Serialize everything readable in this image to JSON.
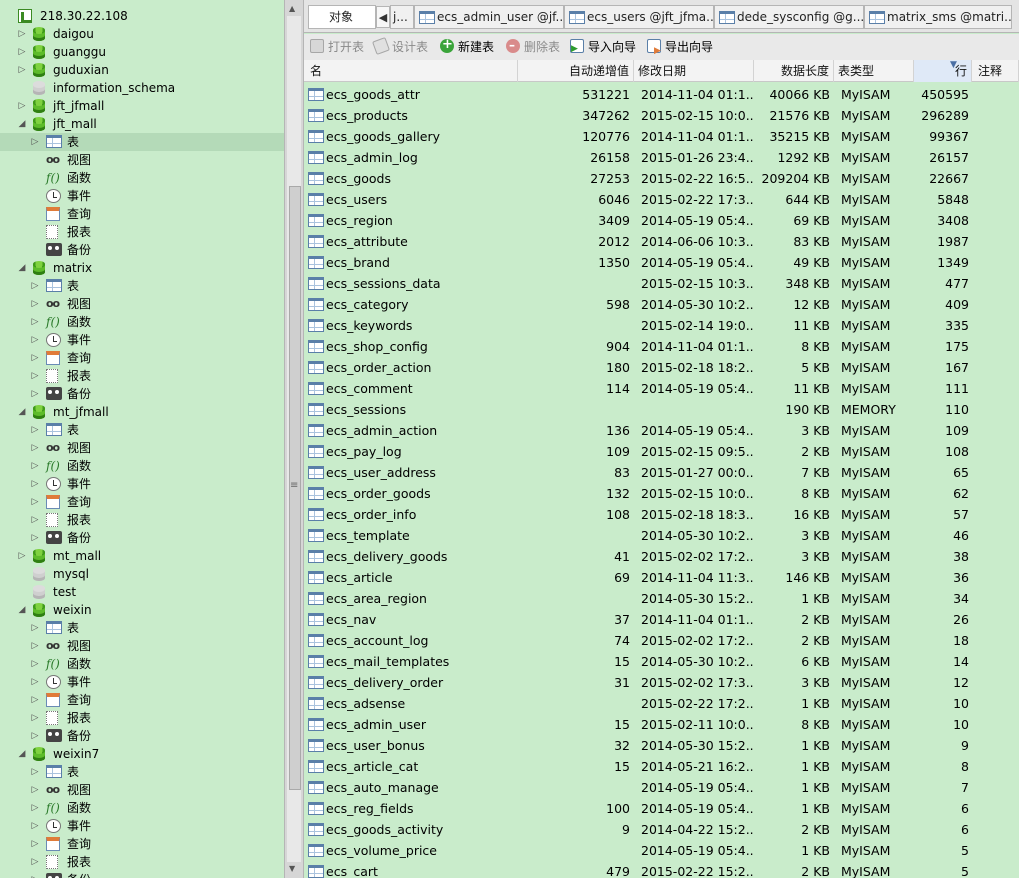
{
  "tree": {
    "server": "218.30.22.108",
    "items": [
      {
        "label": "daigou",
        "type": "db",
        "depth": 1,
        "twisty": "▷"
      },
      {
        "label": "guanggu",
        "type": "db",
        "depth": 1,
        "twisty": "▷"
      },
      {
        "label": "guduxian",
        "type": "db",
        "depth": 1,
        "twisty": "▷"
      },
      {
        "label": "information_schema",
        "type": "db-gray",
        "depth": 1,
        "twisty": ""
      },
      {
        "label": "jft_jfmall",
        "type": "db",
        "depth": 1,
        "twisty": "▷"
      },
      {
        "label": "jft_mall",
        "type": "db",
        "depth": 1,
        "twisty": "◢"
      },
      {
        "label": "表",
        "type": "table",
        "depth": 2,
        "twisty": "▷",
        "selected": true
      },
      {
        "label": "视图",
        "type": "view",
        "depth": 2,
        "twisty": ""
      },
      {
        "label": "函数",
        "type": "func",
        "depth": 2,
        "twisty": ""
      },
      {
        "label": "事件",
        "type": "event",
        "depth": 2,
        "twisty": ""
      },
      {
        "label": "查询",
        "type": "query",
        "depth": 2,
        "twisty": ""
      },
      {
        "label": "报表",
        "type": "report",
        "depth": 2,
        "twisty": ""
      },
      {
        "label": "备份",
        "type": "backup",
        "depth": 2,
        "twisty": ""
      },
      {
        "label": "matrix",
        "type": "db",
        "depth": 1,
        "twisty": "◢"
      },
      {
        "label": "表",
        "type": "table",
        "depth": 2,
        "twisty": "▷"
      },
      {
        "label": "视图",
        "type": "view",
        "depth": 2,
        "twisty": "▷"
      },
      {
        "label": "函数",
        "type": "func",
        "depth": 2,
        "twisty": "▷"
      },
      {
        "label": "事件",
        "type": "event",
        "depth": 2,
        "twisty": "▷"
      },
      {
        "label": "查询",
        "type": "query",
        "depth": 2,
        "twisty": "▷"
      },
      {
        "label": "报表",
        "type": "report",
        "depth": 2,
        "twisty": "▷"
      },
      {
        "label": "备份",
        "type": "backup",
        "depth": 2,
        "twisty": "▷"
      },
      {
        "label": "mt_jfmall",
        "type": "db",
        "depth": 1,
        "twisty": "◢"
      },
      {
        "label": "表",
        "type": "table",
        "depth": 2,
        "twisty": "▷"
      },
      {
        "label": "视图",
        "type": "view",
        "depth": 2,
        "twisty": "▷"
      },
      {
        "label": "函数",
        "type": "func",
        "depth": 2,
        "twisty": "▷"
      },
      {
        "label": "事件",
        "type": "event",
        "depth": 2,
        "twisty": "▷"
      },
      {
        "label": "查询",
        "type": "query",
        "depth": 2,
        "twisty": "▷"
      },
      {
        "label": "报表",
        "type": "report",
        "depth": 2,
        "twisty": "▷"
      },
      {
        "label": "备份",
        "type": "backup",
        "depth": 2,
        "twisty": "▷"
      },
      {
        "label": "mt_mall",
        "type": "db",
        "depth": 1,
        "twisty": "▷"
      },
      {
        "label": "mysql",
        "type": "db-gray",
        "depth": 1,
        "twisty": ""
      },
      {
        "label": "test",
        "type": "db-gray",
        "depth": 1,
        "twisty": ""
      },
      {
        "label": "weixin",
        "type": "db",
        "depth": 1,
        "twisty": "◢"
      },
      {
        "label": "表",
        "type": "table",
        "depth": 2,
        "twisty": "▷"
      },
      {
        "label": "视图",
        "type": "view",
        "depth": 2,
        "twisty": "▷"
      },
      {
        "label": "函数",
        "type": "func",
        "depth": 2,
        "twisty": "▷"
      },
      {
        "label": "事件",
        "type": "event",
        "depth": 2,
        "twisty": "▷"
      },
      {
        "label": "查询",
        "type": "query",
        "depth": 2,
        "twisty": "▷"
      },
      {
        "label": "报表",
        "type": "report",
        "depth": 2,
        "twisty": "▷"
      },
      {
        "label": "备份",
        "type": "backup",
        "depth": 2,
        "twisty": "▷"
      },
      {
        "label": "weixin7",
        "type": "db",
        "depth": 1,
        "twisty": "◢"
      },
      {
        "label": "表",
        "type": "table",
        "depth": 2,
        "twisty": "▷"
      },
      {
        "label": "视图",
        "type": "view",
        "depth": 2,
        "twisty": "▷"
      },
      {
        "label": "函数",
        "type": "func",
        "depth": 2,
        "twisty": "▷"
      },
      {
        "label": "事件",
        "type": "event",
        "depth": 2,
        "twisty": "▷"
      },
      {
        "label": "查询",
        "type": "query",
        "depth": 2,
        "twisty": "▷"
      },
      {
        "label": "报表",
        "type": "report",
        "depth": 2,
        "twisty": "▷"
      },
      {
        "label": "备份",
        "type": "backup",
        "depth": 2,
        "twisty": "▷"
      }
    ]
  },
  "tabs": {
    "active": "对象",
    "items": [
      "j...",
      "ecs_admin_user @jf...",
      "ecs_users @jft_jfma...",
      "dede_sysconfig @g...",
      "matrix_sms @matri..."
    ]
  },
  "toolbar": {
    "open": "打开表",
    "design": "设计表",
    "new": "新建表",
    "delete": "删除表",
    "import": "导入向导",
    "export": "导出向导"
  },
  "columns": {
    "name": "名",
    "auto_increment": "自动递增值",
    "modified": "修改日期",
    "data_length": "数据长度",
    "engine": "表类型",
    "rows": "行",
    "comment": "注释"
  },
  "rows": [
    {
      "name": "ecs_goods_attr",
      "auto": "531221",
      "date": "2014-11-04 01:1...",
      "size": "40066 KB",
      "engine": "MyISAM",
      "rows": "450595"
    },
    {
      "name": "ecs_products",
      "auto": "347262",
      "date": "2015-02-15 10:0...",
      "size": "21576 KB",
      "engine": "MyISAM",
      "rows": "296289"
    },
    {
      "name": "ecs_goods_gallery",
      "auto": "120776",
      "date": "2014-11-04 01:1...",
      "size": "35215 KB",
      "engine": "MyISAM",
      "rows": "99367"
    },
    {
      "name": "ecs_admin_log",
      "auto": "26158",
      "date": "2015-01-26 23:4...",
      "size": "1292 KB",
      "engine": "MyISAM",
      "rows": "26157"
    },
    {
      "name": "ecs_goods",
      "auto": "27253",
      "date": "2015-02-22 16:5...",
      "size": "209204 KB",
      "engine": "MyISAM",
      "rows": "22667"
    },
    {
      "name": "ecs_users",
      "auto": "6046",
      "date": "2015-02-22 17:3...",
      "size": "644 KB",
      "engine": "MyISAM",
      "rows": "5848"
    },
    {
      "name": "ecs_region",
      "auto": "3409",
      "date": "2014-05-19 05:4...",
      "size": "69 KB",
      "engine": "MyISAM",
      "rows": "3408"
    },
    {
      "name": "ecs_attribute",
      "auto": "2012",
      "date": "2014-06-06 10:3...",
      "size": "83 KB",
      "engine": "MyISAM",
      "rows": "1987"
    },
    {
      "name": "ecs_brand",
      "auto": "1350",
      "date": "2014-05-19 05:4...",
      "size": "49 KB",
      "engine": "MyISAM",
      "rows": "1349"
    },
    {
      "name": "ecs_sessions_data",
      "auto": "",
      "date": "2015-02-15 10:3...",
      "size": "348 KB",
      "engine": "MyISAM",
      "rows": "477"
    },
    {
      "name": "ecs_category",
      "auto": "598",
      "date": "2014-05-30 10:2...",
      "size": "12 KB",
      "engine": "MyISAM",
      "rows": "409"
    },
    {
      "name": "ecs_keywords",
      "auto": "",
      "date": "2015-02-14 19:0...",
      "size": "11 KB",
      "engine": "MyISAM",
      "rows": "335"
    },
    {
      "name": "ecs_shop_config",
      "auto": "904",
      "date": "2014-11-04 01:1...",
      "size": "8 KB",
      "engine": "MyISAM",
      "rows": "175"
    },
    {
      "name": "ecs_order_action",
      "auto": "180",
      "date": "2015-02-18 18:2...",
      "size": "5 KB",
      "engine": "MyISAM",
      "rows": "167"
    },
    {
      "name": "ecs_comment",
      "auto": "114",
      "date": "2014-05-19 05:4...",
      "size": "11 KB",
      "engine": "MyISAM",
      "rows": "111"
    },
    {
      "name": "ecs_sessions",
      "auto": "",
      "date": "",
      "size": "190 KB",
      "engine": "MEMORY",
      "rows": "110"
    },
    {
      "name": "ecs_admin_action",
      "auto": "136",
      "date": "2014-05-19 05:4...",
      "size": "3 KB",
      "engine": "MyISAM",
      "rows": "109"
    },
    {
      "name": "ecs_pay_log",
      "auto": "109",
      "date": "2015-02-15 09:5...",
      "size": "2 KB",
      "engine": "MyISAM",
      "rows": "108"
    },
    {
      "name": "ecs_user_address",
      "auto": "83",
      "date": "2015-01-27 00:0...",
      "size": "7 KB",
      "engine": "MyISAM",
      "rows": "65"
    },
    {
      "name": "ecs_order_goods",
      "auto": "132",
      "date": "2015-02-15 10:0...",
      "size": "8 KB",
      "engine": "MyISAM",
      "rows": "62"
    },
    {
      "name": "ecs_order_info",
      "auto": "108",
      "date": "2015-02-18 18:3...",
      "size": "16 KB",
      "engine": "MyISAM",
      "rows": "57"
    },
    {
      "name": "ecs_template",
      "auto": "",
      "date": "2014-05-30 10:2...",
      "size": "3 KB",
      "engine": "MyISAM",
      "rows": "46"
    },
    {
      "name": "ecs_delivery_goods",
      "auto": "41",
      "date": "2015-02-02 17:2...",
      "size": "3 KB",
      "engine": "MyISAM",
      "rows": "38"
    },
    {
      "name": "ecs_article",
      "auto": "69",
      "date": "2014-11-04 11:3...",
      "size": "146 KB",
      "engine": "MyISAM",
      "rows": "36"
    },
    {
      "name": "ecs_area_region",
      "auto": "",
      "date": "2014-05-30 15:2...",
      "size": "1 KB",
      "engine": "MyISAM",
      "rows": "34"
    },
    {
      "name": "ecs_nav",
      "auto": "37",
      "date": "2014-11-04 01:1...",
      "size": "2 KB",
      "engine": "MyISAM",
      "rows": "26"
    },
    {
      "name": "ecs_account_log",
      "auto": "74",
      "date": "2015-02-02 17:2...",
      "size": "2 KB",
      "engine": "MyISAM",
      "rows": "18"
    },
    {
      "name": "ecs_mail_templates",
      "auto": "15",
      "date": "2014-05-30 10:2...",
      "size": "6 KB",
      "engine": "MyISAM",
      "rows": "14"
    },
    {
      "name": "ecs_delivery_order",
      "auto": "31",
      "date": "2015-02-02 17:3...",
      "size": "3 KB",
      "engine": "MyISAM",
      "rows": "12"
    },
    {
      "name": "ecs_adsense",
      "auto": "",
      "date": "2015-02-22 17:2...",
      "size": "1 KB",
      "engine": "MyISAM",
      "rows": "10"
    },
    {
      "name": "ecs_admin_user",
      "auto": "15",
      "date": "2015-02-11 10:0...",
      "size": "8 KB",
      "engine": "MyISAM",
      "rows": "10"
    },
    {
      "name": "ecs_user_bonus",
      "auto": "32",
      "date": "2014-05-30 15:2...",
      "size": "1 KB",
      "engine": "MyISAM",
      "rows": "9"
    },
    {
      "name": "ecs_article_cat",
      "auto": "15",
      "date": "2014-05-21 16:2...",
      "size": "1 KB",
      "engine": "MyISAM",
      "rows": "8"
    },
    {
      "name": "ecs_auto_manage",
      "auto": "",
      "date": "2014-05-19 05:4...",
      "size": "1 KB",
      "engine": "MyISAM",
      "rows": "7"
    },
    {
      "name": "ecs_reg_fields",
      "auto": "100",
      "date": "2014-05-19 05:4...",
      "size": "1 KB",
      "engine": "MyISAM",
      "rows": "6"
    },
    {
      "name": "ecs_goods_activity",
      "auto": "9",
      "date": "2014-04-22 15:2...",
      "size": "2 KB",
      "engine": "MyISAM",
      "rows": "6"
    },
    {
      "name": "ecs_volume_price",
      "auto": "",
      "date": "2014-05-19 05:4...",
      "size": "1 KB",
      "engine": "MyISAM",
      "rows": "5"
    },
    {
      "name": "ecs_cart",
      "auto": "479",
      "date": "2015-02-22 15:2...",
      "size": "2 KB",
      "engine": "MyISAM",
      "rows": "5"
    }
  ]
}
